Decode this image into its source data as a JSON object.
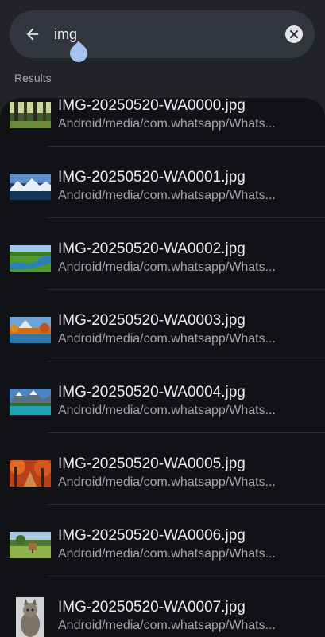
{
  "search": {
    "query": "img",
    "placeholder": ""
  },
  "results_label": "Results",
  "results": [
    {
      "name": "IMG-20250520-WA0000.jpg",
      "path": "Android/media/com.whatsapp/Whats..."
    },
    {
      "name": "IMG-20250520-WA0001.jpg",
      "path": "Android/media/com.whatsapp/Whats..."
    },
    {
      "name": "IMG-20250520-WA0002.jpg",
      "path": "Android/media/com.whatsapp/Whats..."
    },
    {
      "name": "IMG-20250520-WA0003.jpg",
      "path": "Android/media/com.whatsapp/Whats..."
    },
    {
      "name": "IMG-20250520-WA0004.jpg",
      "path": "Android/media/com.whatsapp/Whats..."
    },
    {
      "name": "IMG-20250520-WA0005.jpg",
      "path": "Android/media/com.whatsapp/Whats..."
    },
    {
      "name": "IMG-20250520-WA0006.jpg",
      "path": "Android/media/com.whatsapp/Whats..."
    },
    {
      "name": "IMG-20250520-WA0007.jpg",
      "path": "Android/media/com.whatsapp/Whats..."
    }
  ],
  "icons": {
    "back": "arrow-back-icon",
    "clear": "close-circle-icon"
  },
  "colors": {
    "background": "#212329",
    "search_bar": "#33363d",
    "list_background": "#111215",
    "primary_text": "#ecedf0",
    "secondary_text": "#a3a5ab",
    "cursor_handle": "#a7c2f0"
  }
}
